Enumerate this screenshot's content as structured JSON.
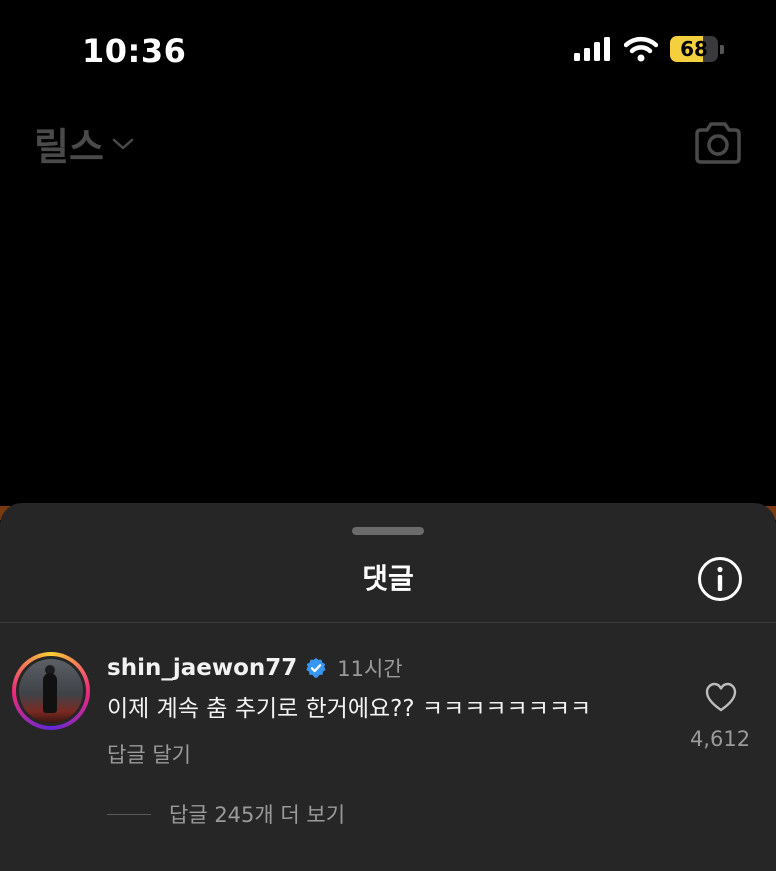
{
  "status_bar": {
    "time": "10:36",
    "battery_level": "68",
    "battery_fraction": 0.68,
    "icons": [
      "cellular-signal-icon",
      "wifi-icon",
      "battery-icon"
    ]
  },
  "header": {
    "title": "릴스",
    "icons": [
      "chevron-down-icon",
      "camera-icon"
    ]
  },
  "comments_sheet": {
    "title": "댓글",
    "icons": [
      "info-icon"
    ],
    "comment": {
      "username": "shin_jaewon77",
      "verified": true,
      "time_ago": "11시간",
      "text": "이제 계속 춤 추기로 한거에요?? ㅋㅋㅋㅋㅋㅋㅋㅋ",
      "reply_label": "답글 달기",
      "like_count": "4,612",
      "view_replies_label": "답글 245개 더 보기"
    }
  },
  "colors": {
    "sheet_background": "#262626",
    "battery_fill": "#f4d03f",
    "verified_badge": "#3797f0",
    "secondary_text": "#9a9a9a"
  }
}
